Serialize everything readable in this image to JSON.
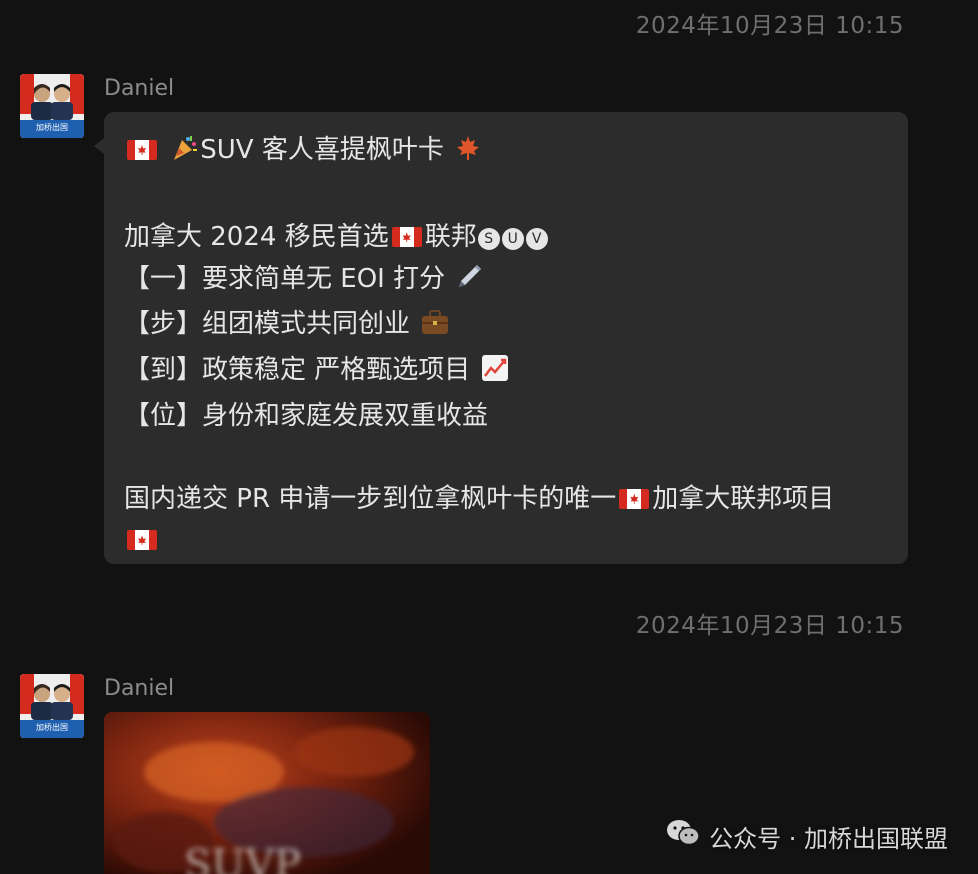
{
  "messages": [
    {
      "timestamp": "2024年10月23日 10:15",
      "sender": "Daniel",
      "avatar_caption": "加桥出国",
      "lines": {
        "l1_text": "SUV 客人喜提枫叶卡",
        "l2_pre": "加拿大 2024 移民首选",
        "l2_post": "联邦",
        "l2_badges": [
          "S",
          "U",
          "V"
        ],
        "l3": "【一】要求简单无 EOI 打分",
        "l4": "【步】组团模式共同创业",
        "l5": "【到】政策稳定 严格甄选项目",
        "l6": "【位】身份和家庭发展双重收益",
        "l7_pre": "国内递交 PR 申请一步到位拿枫叶卡的唯一",
        "l7_post": "加拿大联邦项目"
      }
    },
    {
      "timestamp": "2024年10月23日 10:15",
      "sender": "Daniel",
      "avatar_caption": "加桥出国",
      "image_text": "SUVP"
    }
  ],
  "watermark": {
    "label": "公众号 · 加桥出国联盟",
    "icon": "wechat-icon"
  },
  "colors": {
    "background": "#121212",
    "bubble": "#2c2c2c",
    "text": "#e6e6e6",
    "meta": "#6f6f6f"
  }
}
